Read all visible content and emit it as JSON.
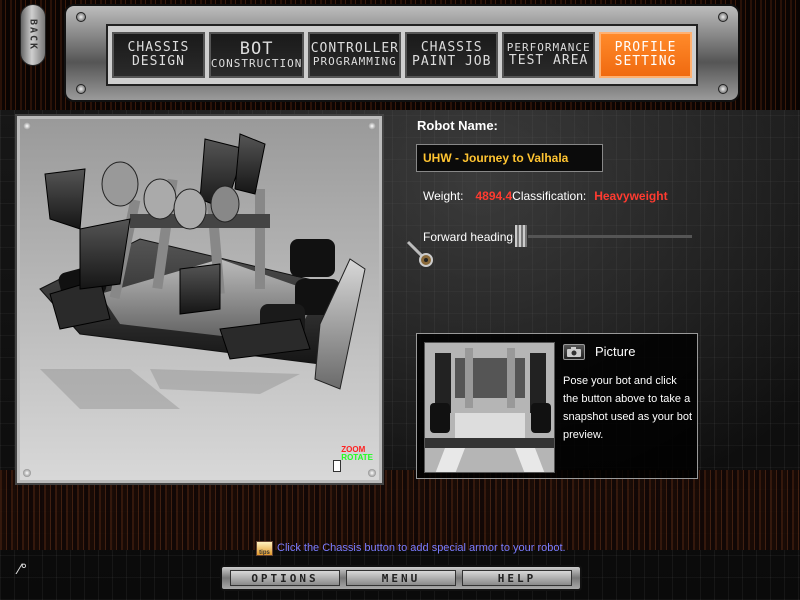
{
  "back_button": {
    "label": "BACK"
  },
  "nav": {
    "tabs": [
      {
        "line1": "CHASSIS",
        "line2": "DESIGN",
        "active": false
      },
      {
        "line1": "BOT",
        "line2": "CONSTRUCTION",
        "active": false
      },
      {
        "line1": "CONTROLLER",
        "line2": "PROGRAMMING",
        "active": false
      },
      {
        "line1": "CHASSIS",
        "line2": "PAINT JOB",
        "active": false
      },
      {
        "line1": "PERFORMANCE",
        "line2": "TEST AREA",
        "active": false
      },
      {
        "line1": "PROFILE",
        "line2": "SETTING",
        "active": true
      }
    ]
  },
  "viewport": {
    "zoom_label": "ZOOM",
    "rotate_label": "ROTATE"
  },
  "profile": {
    "robot_name_label": "Robot Name:",
    "robot_name": "UHW - Journey to Valhala",
    "weight_label": "Weight:",
    "weight_value": "4894.4",
    "classification_label": "Classification:",
    "classification_value": "Heavyweight",
    "forward_heading_label": "Forward heading:"
  },
  "picture": {
    "title": "Picture",
    "description": "Pose your bot and click the button above to take a snapshot used as your bot preview."
  },
  "tips": {
    "text": "Click the Chassis button to add special armor to your robot."
  },
  "bottom_menu": {
    "options": "OPTIONS",
    "menu": "MENU",
    "help": "HELP"
  },
  "colors": {
    "accent": "#f47a1c",
    "name_text": "#ffc431",
    "warning_text": "#ff3b30",
    "tips_text": "#7b7cff"
  },
  "icons": {
    "camera": "camera-icon",
    "dial": "heading-dial-icon",
    "tips": "tips-icon"
  }
}
